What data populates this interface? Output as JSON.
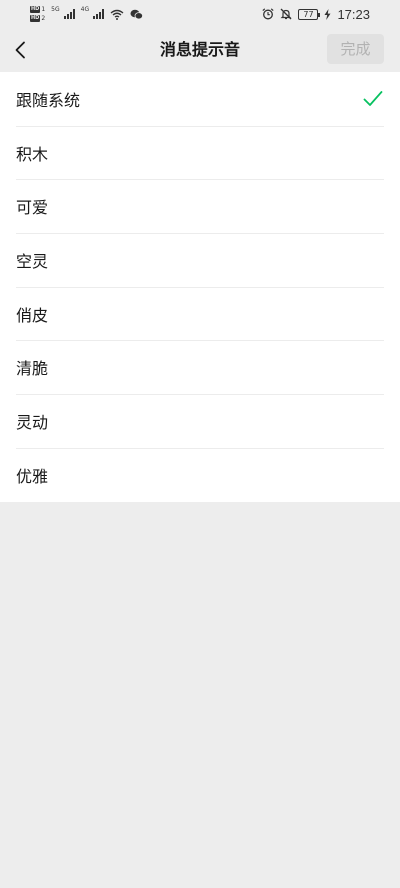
{
  "status_bar": {
    "left": {
      "sim1_badge": "HD",
      "sim1_num": "1",
      "sim2_badge": "HD",
      "sim2_num": "2",
      "sim1_network": "5G",
      "sim2_network": "4G",
      "icons": [
        "hd-sim-badge-icon",
        "signal-icon",
        "wifi-icon",
        "wechat-icon"
      ]
    },
    "right": {
      "icons": [
        "alarm-icon",
        "mute-icon",
        "battery-icon",
        "charging-icon"
      ],
      "battery_level": "77",
      "time": "17:23"
    }
  },
  "nav": {
    "title": "消息提示音",
    "back_icon": "chevron-left-icon",
    "done_label": "完成",
    "done_enabled": false
  },
  "sounds": [
    {
      "label": "跟随系统",
      "selected": true
    },
    {
      "label": "积木",
      "selected": false
    },
    {
      "label": "可爱",
      "selected": false
    },
    {
      "label": "空灵",
      "selected": false
    },
    {
      "label": "俏皮",
      "selected": false
    },
    {
      "label": "清脆",
      "selected": false
    },
    {
      "label": "灵动",
      "selected": false
    },
    {
      "label": "优雅",
      "selected": false
    }
  ],
  "colors": {
    "page_background": "#ededed",
    "list_background": "#ffffff",
    "check_accent": "#07c160",
    "done_disabled_bg": "#e1e1e1",
    "done_disabled_text": "#b2b2b2"
  },
  "check_icon": "checkmark-icon"
}
